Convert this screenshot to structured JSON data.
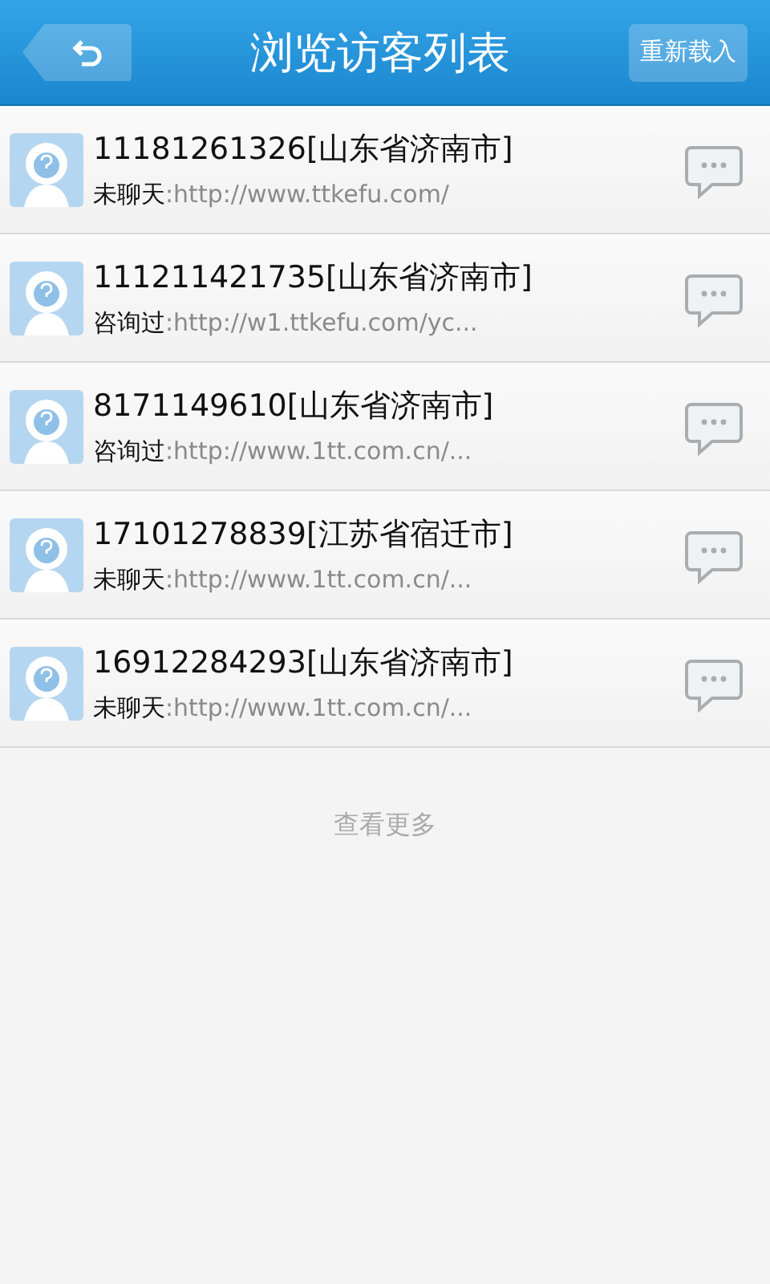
{
  "header": {
    "title": "浏览访客列表",
    "reload_button": "重新载入"
  },
  "visitors": [
    {
      "name": "11181261326[山东省济南市]",
      "status": "未聊天",
      "url": ":http://www.ttkefu.com/"
    },
    {
      "name": "111211421735[山东省济南市]",
      "status": "咨询过",
      "url": ":http://w1.ttkefu.com/yc..."
    },
    {
      "name": "8171149610[山东省济南市]",
      "status": "咨询过",
      "url": ":http://www.1tt.com.cn/..."
    },
    {
      "name": "17101278839[江苏省宿迁市]",
      "status": "未聊天",
      "url": ":http://www.1tt.com.cn/..."
    },
    {
      "name": "16912284293[山东省济南市]",
      "status": "未聊天",
      "url": ":http://www.1tt.com.cn/..."
    }
  ],
  "more_link": "查看更多"
}
